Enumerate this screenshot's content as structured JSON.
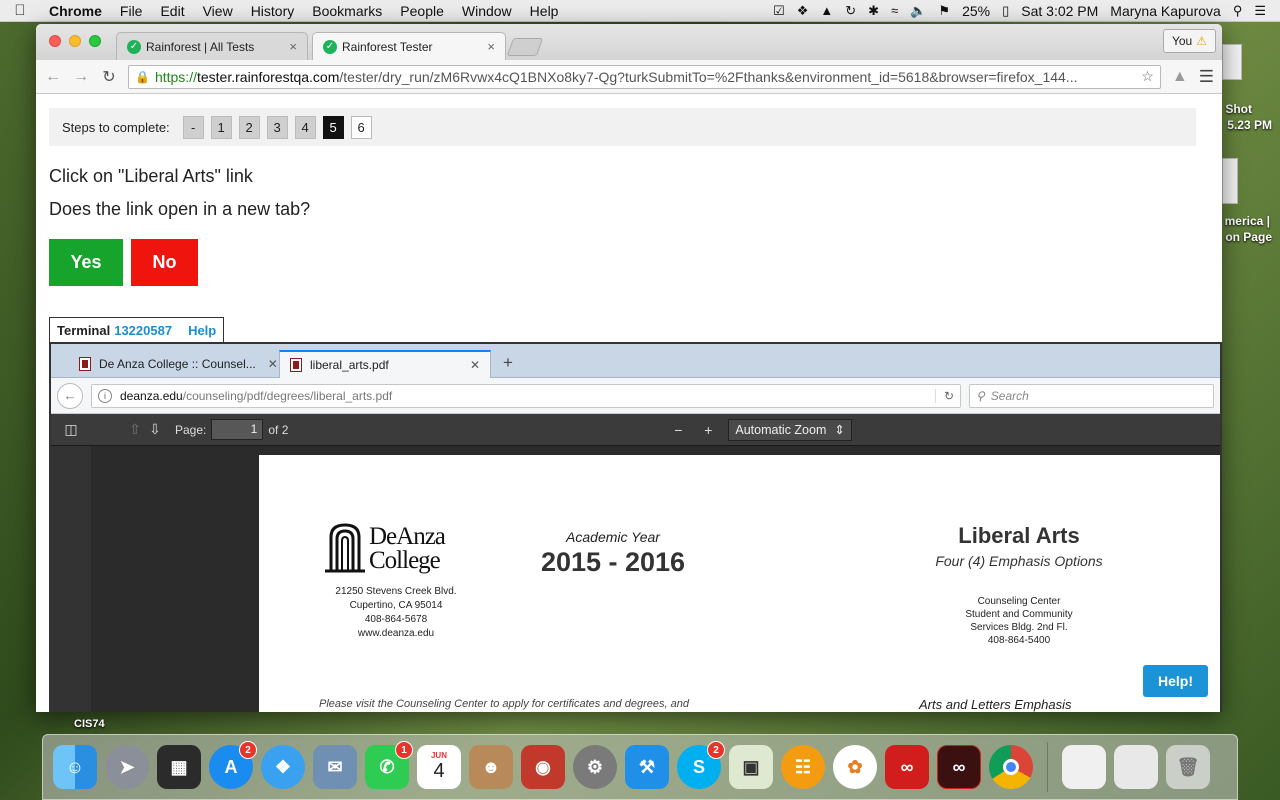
{
  "menubar": {
    "app": "Chrome",
    "items": [
      "File",
      "Edit",
      "View",
      "History",
      "Bookmarks",
      "People",
      "Window",
      "Help"
    ],
    "battery": "25%",
    "clock": "Sat 3:02 PM",
    "user": "Maryna Kapurova"
  },
  "desktop": {
    "screenshot_label_1": "Shot",
    "screenshot_label_2": "5.23 PM",
    "doc_label_1": "merica |",
    "doc_label_2": "on Page",
    "cis_label": "CIS74"
  },
  "browser": {
    "tabs": [
      {
        "label": "Rainforest | All Tests"
      },
      {
        "label": "Rainforest Tester"
      }
    ],
    "profile_label": "You",
    "url": {
      "scheme": "https://",
      "host": "tester.rainforestqa.com",
      "rest": "/tester/dry_run/zM6Rvwx4cQ1BNXo8ky7-Qg?turkSubmitTo=%2Fthanks&environment_id=5618&browser=firefox_144..."
    }
  },
  "task": {
    "steps_label": "Steps to complete:",
    "steps": [
      "-",
      "1",
      "2",
      "3",
      "4",
      "5",
      "6"
    ],
    "current_step": "5",
    "instruction": "Click on \"Liberal Arts\" link",
    "question": "Does the link open in a new tab?",
    "yes_label": "Yes",
    "no_label": "No"
  },
  "terminal": {
    "label": "Terminal",
    "id": "13220587",
    "help": "Help"
  },
  "firefox": {
    "tabs": [
      {
        "label": "De Anza College :: Counsel..."
      },
      {
        "label": "liberal_arts.pdf"
      }
    ],
    "url_domain": "deanza.edu",
    "url_path": "/counseling/pdf/degrees/liberal_arts.pdf",
    "search_placeholder": "Search",
    "pdf_toolbar": {
      "page_label": "Page:",
      "page_value": "1",
      "page_of": "of 2",
      "zoom": "Automatic Zoom"
    }
  },
  "pdf": {
    "logo_line1": "DeAnza",
    "logo_line2": "College",
    "address": [
      "21250 Stevens Creek Blvd.",
      "Cupertino, CA 95014",
      "408-864-5678",
      "www.deanza.edu"
    ],
    "academic_year_label": "Academic Year",
    "academic_year": "2015 - 2016",
    "title": "Liberal Arts",
    "subtitle": "Four (4) Emphasis Options",
    "center_info": [
      "Counseling Center",
      "Student and Community",
      "Services Bldg. 2nd Fl.",
      "408-864-5400"
    ],
    "bottom_left": "Please visit the Counseling Center to apply for certificates and degrees, and",
    "bottom_right": "Arts and Letters Emphasis"
  },
  "help_button": "Help!",
  "dock": {
    "badges": {
      "appstore": "2",
      "facetime": "1",
      "skype": "2"
    },
    "calendar_month": "JUN",
    "calendar_day": "4"
  }
}
